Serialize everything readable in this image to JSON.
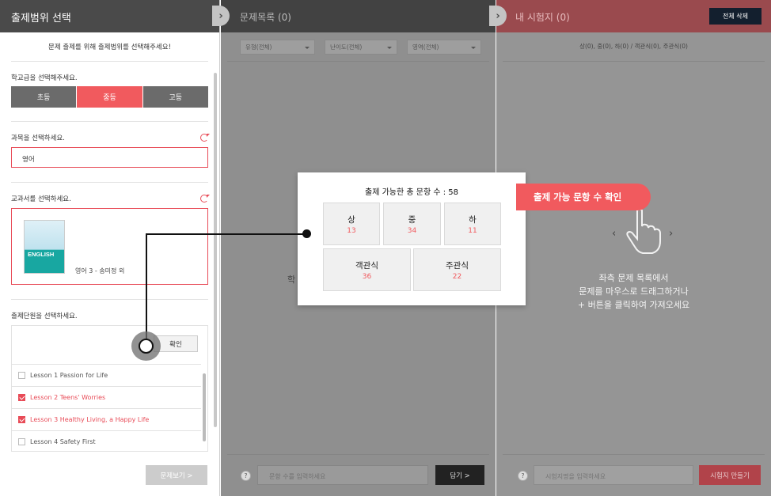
{
  "left": {
    "title": "출제범위 선택",
    "notice": "문제 출제를 위해 출제범위를 선택해주세요!",
    "school_level": {
      "label": "학교급을 선택해주세요.",
      "options": [
        "초등",
        "중등",
        "고등"
      ],
      "selected": "중등"
    },
    "subject": {
      "label": "과목을 선택하세요.",
      "value": "영어"
    },
    "textbook": {
      "label": "교과서를 선택하세요.",
      "cover_title": "ENGLISH",
      "caption": "영어 3 - 송미정 외"
    },
    "units": {
      "label": "출제단원을 선택하세요.",
      "confirm": "확인",
      "items": [
        {
          "label": "Lesson 1 Passion for Life",
          "checked": false
        },
        {
          "label": "Lesson 2 Teens' Worries",
          "checked": true
        },
        {
          "label": "Lesson 3 Healthy Living, a Happy Life",
          "checked": true
        },
        {
          "label": "Lesson 4 Safety First",
          "checked": false
        }
      ]
    },
    "view_button": "문제보기 >"
  },
  "middle": {
    "title": "문제목록 (0)",
    "filters": [
      "유형(전체)",
      "난이도(전체)",
      "영역(전체)"
    ],
    "partial_text": "학",
    "help": "?",
    "input_placeholder": "문항 수를 입력하세요",
    "add_button": "담기 >"
  },
  "right": {
    "title": "내 시험지 (0)",
    "delete_all": "전체 삭제",
    "summary": "상(0), 중(0), 하(0) / 객관식(0), 주관식(0)",
    "hint_lines": [
      "좌측 문제 목록에서",
      "문제를 마우스로 드래그하거나",
      "+ 버튼을 클릭하여 가져오세요"
    ],
    "help": "?",
    "input_placeholder": "시험지명을 입력하세요",
    "make_button": "시험지 만들기"
  },
  "popup": {
    "title": "출제 가능한 총 문항 수 : 58",
    "difficulty": [
      {
        "label": "상",
        "value": "13"
      },
      {
        "label": "중",
        "value": "34"
      },
      {
        "label": "하",
        "value": "11"
      }
    ],
    "types": [
      {
        "label": "객관식",
        "value": "36"
      },
      {
        "label": "주관식",
        "value": "22"
      }
    ]
  },
  "callout": "출제 가능 문항 수 확인",
  "colors": {
    "accent": "#f15a5e",
    "header_dark": "#4a4a4a",
    "delete_btn": "#131f2e"
  }
}
